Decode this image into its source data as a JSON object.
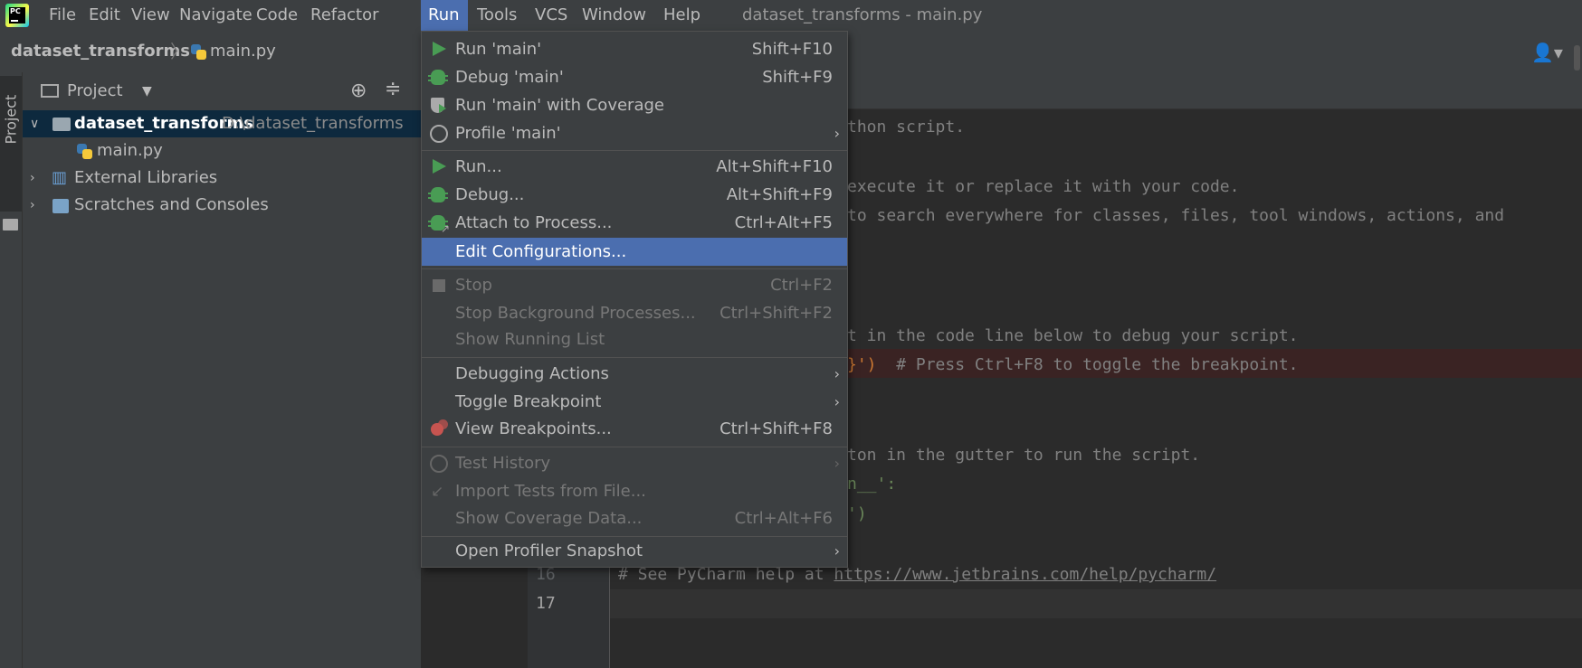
{
  "menubar": {
    "items": [
      {
        "label": "File"
      },
      {
        "label": "Edit"
      },
      {
        "label": "View"
      },
      {
        "label": "Navigate"
      },
      {
        "label": "Code"
      },
      {
        "label": "Refactor"
      },
      {
        "label": "Run"
      },
      {
        "label": "Tools"
      },
      {
        "label": "VCS"
      },
      {
        "label": "Window"
      },
      {
        "label": "Help"
      }
    ],
    "window_title": "dataset_transforms - main.py"
  },
  "navbar": {
    "project": "dataset_transforms",
    "file": "main.py"
  },
  "sidebar": {
    "stripe_label": "Project"
  },
  "project_panel": {
    "title": "Project",
    "tree": [
      {
        "label": "dataset_transforms",
        "path": "D:\\dataset_transforms"
      },
      {
        "label": "main.py"
      },
      {
        "label": "External Libraries"
      },
      {
        "label": "Scratches and Consoles"
      }
    ]
  },
  "run_menu": {
    "items": [
      {
        "label": "Run 'main'",
        "shortcut": "Shift+F10"
      },
      {
        "label": "Debug 'main'",
        "shortcut": "Shift+F9"
      },
      {
        "label": "Run 'main' with Coverage",
        "shortcut": ""
      },
      {
        "label": "Profile 'main'",
        "shortcut": ""
      },
      {
        "label": "Run...",
        "shortcut": "Alt+Shift+F10"
      },
      {
        "label": "Debug...",
        "shortcut": "Alt+Shift+F9"
      },
      {
        "label": "Attach to Process...",
        "shortcut": "Ctrl+Alt+F5"
      },
      {
        "label": "Edit Configurations...",
        "shortcut": ""
      },
      {
        "label": "Stop",
        "shortcut": "Ctrl+F2"
      },
      {
        "label": "Stop Background Processes...",
        "shortcut": "Ctrl+Shift+F2"
      },
      {
        "label": "Show Running List",
        "shortcut": ""
      },
      {
        "label": "Debugging Actions",
        "shortcut": ""
      },
      {
        "label": "Toggle Breakpoint",
        "shortcut": ""
      },
      {
        "label": "View Breakpoints...",
        "shortcut": "Ctrl+Shift+F8"
      },
      {
        "label": "Test History",
        "shortcut": ""
      },
      {
        "label": "Import Tests from File...",
        "shortcut": ""
      },
      {
        "label": "Show Coverage Data...",
        "shortcut": "Ctrl+Alt+F6"
      },
      {
        "label": "Open Profiler Snapshot",
        "shortcut": ""
      }
    ]
  },
  "editor": {
    "visible_lines": [
      {
        "text": "thon script."
      },
      {
        "text": "execute it or replace it with your code."
      },
      {
        "text": "to search everywhere for classes, files, tool windows, actions, and"
      },
      {
        "text": "t in the code line below to debug your script."
      },
      {
        "text_a": "}')",
        "text_b": "  # Press Ctrl+F8 to toggle the breakpoint."
      },
      {
        "text": "ton in the gutter to run the script."
      },
      {
        "text": "n__':"
      },
      {
        "text": "')"
      },
      {
        "text_a": "# See PyCharm help at ",
        "link": "https://www.jetbrains.com/help/pycharm/"
      }
    ],
    "line_numbers": [
      {
        "number": "16"
      },
      {
        "number": "17"
      }
    ]
  },
  "colors": {
    "menu_highlight": "#4b6eaf",
    "panel_bg": "#3c3f41",
    "editor_bg": "#2b2b2b",
    "breakpoint_line": "#3a2323"
  }
}
